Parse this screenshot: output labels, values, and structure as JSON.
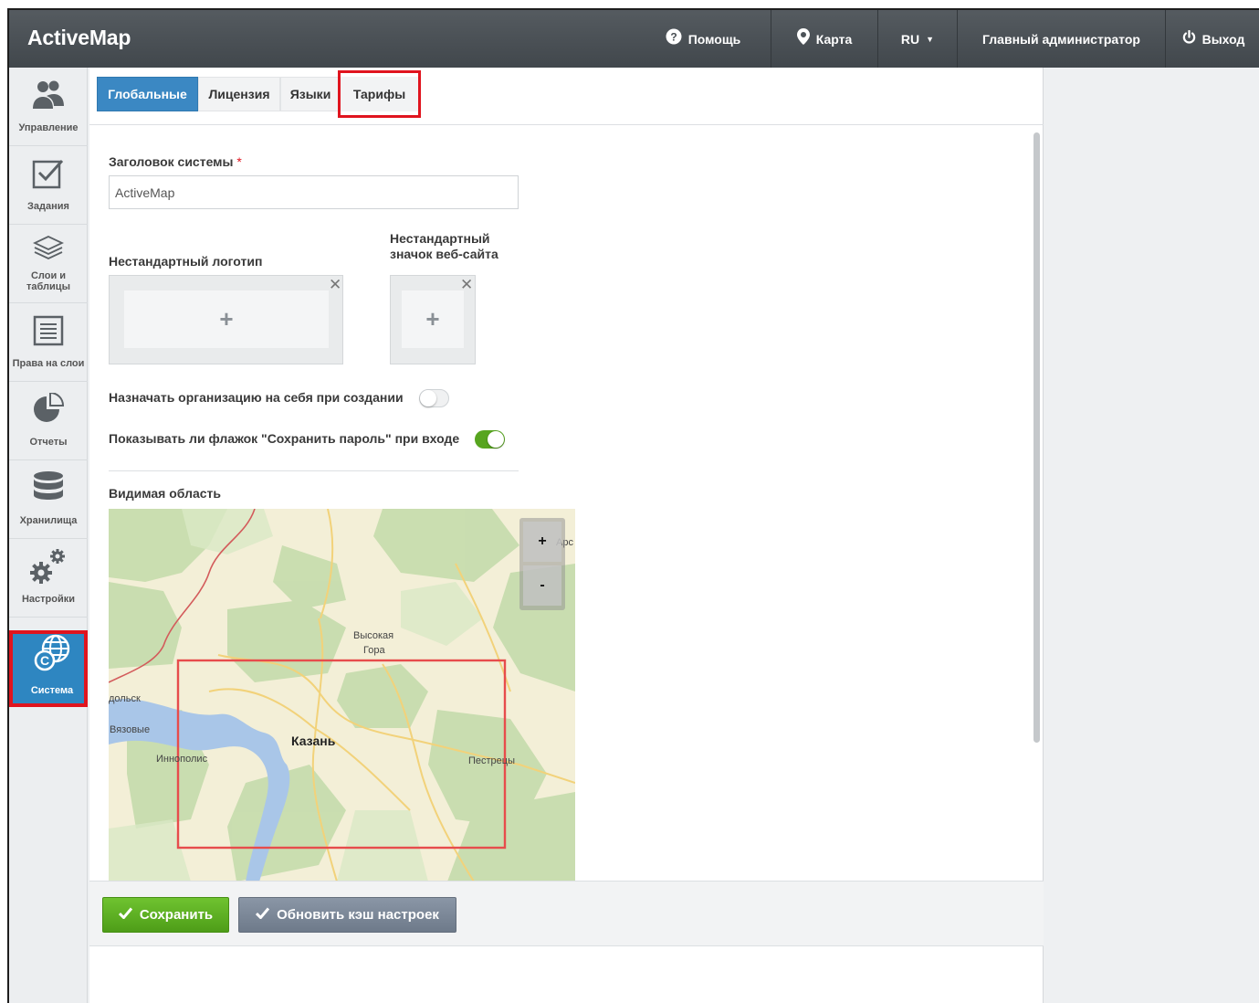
{
  "app": {
    "title": "ActiveMap"
  },
  "header": {
    "help": {
      "icon": "question-circle-icon",
      "label": "Помощь"
    },
    "map": {
      "icon": "map-marker-icon",
      "label": "Карта"
    },
    "lang": {
      "label": "RU"
    },
    "user": {
      "label": "Главный администратор"
    },
    "logout": {
      "icon": "power-icon",
      "label": "Выход"
    }
  },
  "sidebar": {
    "items": [
      {
        "label": "Управление",
        "icon": "users-icon"
      },
      {
        "label": "Задания",
        "icon": "checkbox-icon"
      },
      {
        "label": "Слои и таблицы",
        "icon": "layers-icon"
      },
      {
        "label": "Права на слои",
        "icon": "document-list-icon"
      },
      {
        "label": "Отчеты",
        "icon": "pie-chart-icon"
      },
      {
        "label": "Хранилища",
        "icon": "database-icon"
      },
      {
        "label": "Настройки",
        "icon": "gears-icon"
      },
      {
        "label": "Система",
        "icon": "globe-copyright-icon",
        "active": true
      }
    ]
  },
  "tabs": [
    {
      "label": "Глобальные",
      "active": true
    },
    {
      "label": "Лицензия"
    },
    {
      "label": "Языки"
    },
    {
      "label": "Тарифы",
      "highlighted": true
    }
  ],
  "form": {
    "system_title": {
      "label": "Заголовок системы",
      "required_mark": "*",
      "value": "ActiveMap"
    },
    "logo": {
      "label": "Нестандартный логотип"
    },
    "favicon": {
      "label_line1": "Нестандартный",
      "label_line2": "значок веб-сайта"
    },
    "assign_org": {
      "label": "Назначать организацию на себя при создании",
      "enabled": false
    },
    "show_remember": {
      "label": "Показывать ли флажок \"Сохранить пароль\" при входе",
      "enabled": true
    },
    "visible_area": {
      "label": "Видимая область"
    }
  },
  "map": {
    "zoom_in": "+",
    "zoom_out": "-",
    "labels": {
      "vysokaya": "Высокая",
      "gora": "Гора",
      "kazan": "Казань",
      "vyazovye": "Вязовые",
      "innopolis": "Иннополис",
      "pestretsy": "Пестрецы",
      "zelenodolsk": "дольск",
      "arsk": "Арс"
    },
    "colors": {
      "land": "#f3efd7",
      "forest": "#c5dcac",
      "water": "#a9c6e8",
      "road": "#f2d27a",
      "selection": "#e74c4c"
    }
  },
  "footer": {
    "save": "Сохранить",
    "refresh_cache": "Обновить кэш настроек"
  }
}
